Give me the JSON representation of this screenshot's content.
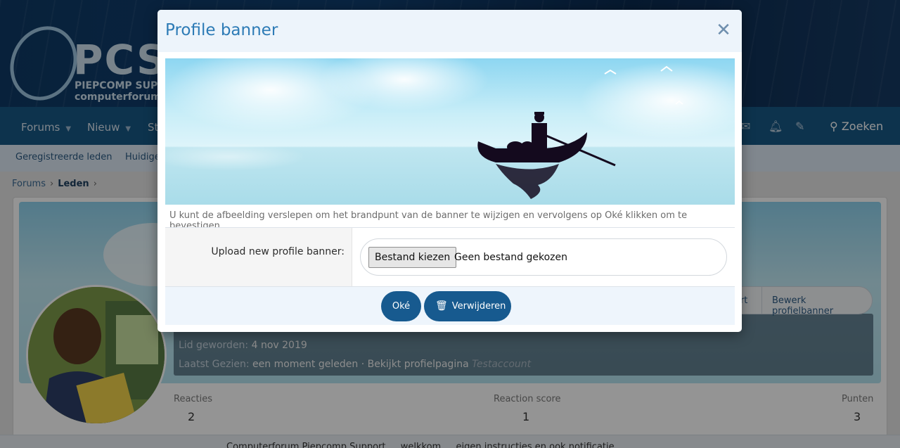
{
  "site": {
    "logo_word": "PCS",
    "logo_tagline1": "PIEPCOMP SUPP",
    "logo_tagline2": "computerforum"
  },
  "navbar": {
    "items": [
      {
        "label": "Forums",
        "has_caret": true
      },
      {
        "label": "Nieuw",
        "has_caret": true
      },
      {
        "label": "St",
        "has_caret": false
      }
    ],
    "icons": [
      "mail-icon",
      "bell-icon",
      "brush-icon"
    ],
    "search_label": "Zoeken"
  },
  "subnav": {
    "items": [
      "Geregistreerde leden",
      "Huidige"
    ]
  },
  "breadcrumb": {
    "items": [
      "Forums",
      "Leden"
    ]
  },
  "profile": {
    "joined_label": "Lid geworden:",
    "joined_value": "4 nov 2019",
    "last_seen_label": "Laatst Gezien:",
    "last_seen_value": "een moment geleden · Bekijkt profielpagina",
    "last_seen_user": "Testaccount",
    "buttons": [
      "ort",
      "Bewerk profielbanner"
    ],
    "stats": [
      {
        "label": "Reacties",
        "value": "2"
      },
      {
        "label": "Reaction score",
        "value": "1"
      },
      {
        "label": "Punten",
        "value": "3"
      }
    ]
  },
  "footer": {
    "text": "Computerforum Piepcomp Support … welkkom … eigen instructies en ook notificatie…"
  },
  "modal": {
    "title": "Profile banner",
    "close_icon": "close-icon",
    "help_text": "U kunt de afbeelding verslepen om het brandpunt van de banner te wijzigen en vervolgens op Oké klikken om te bevestigen.",
    "upload_label": "Upload new profile banner:",
    "file_button_label": "Bestand kiezen",
    "file_status": "Geen bestand gekozen",
    "ok_label": "Oké",
    "delete_label": "Verwijderen",
    "delete_icon": "trash-icon"
  },
  "colors": {
    "primary": "#175a8f",
    "modal_title": "#2d7bb6",
    "navbar": "#185886"
  }
}
